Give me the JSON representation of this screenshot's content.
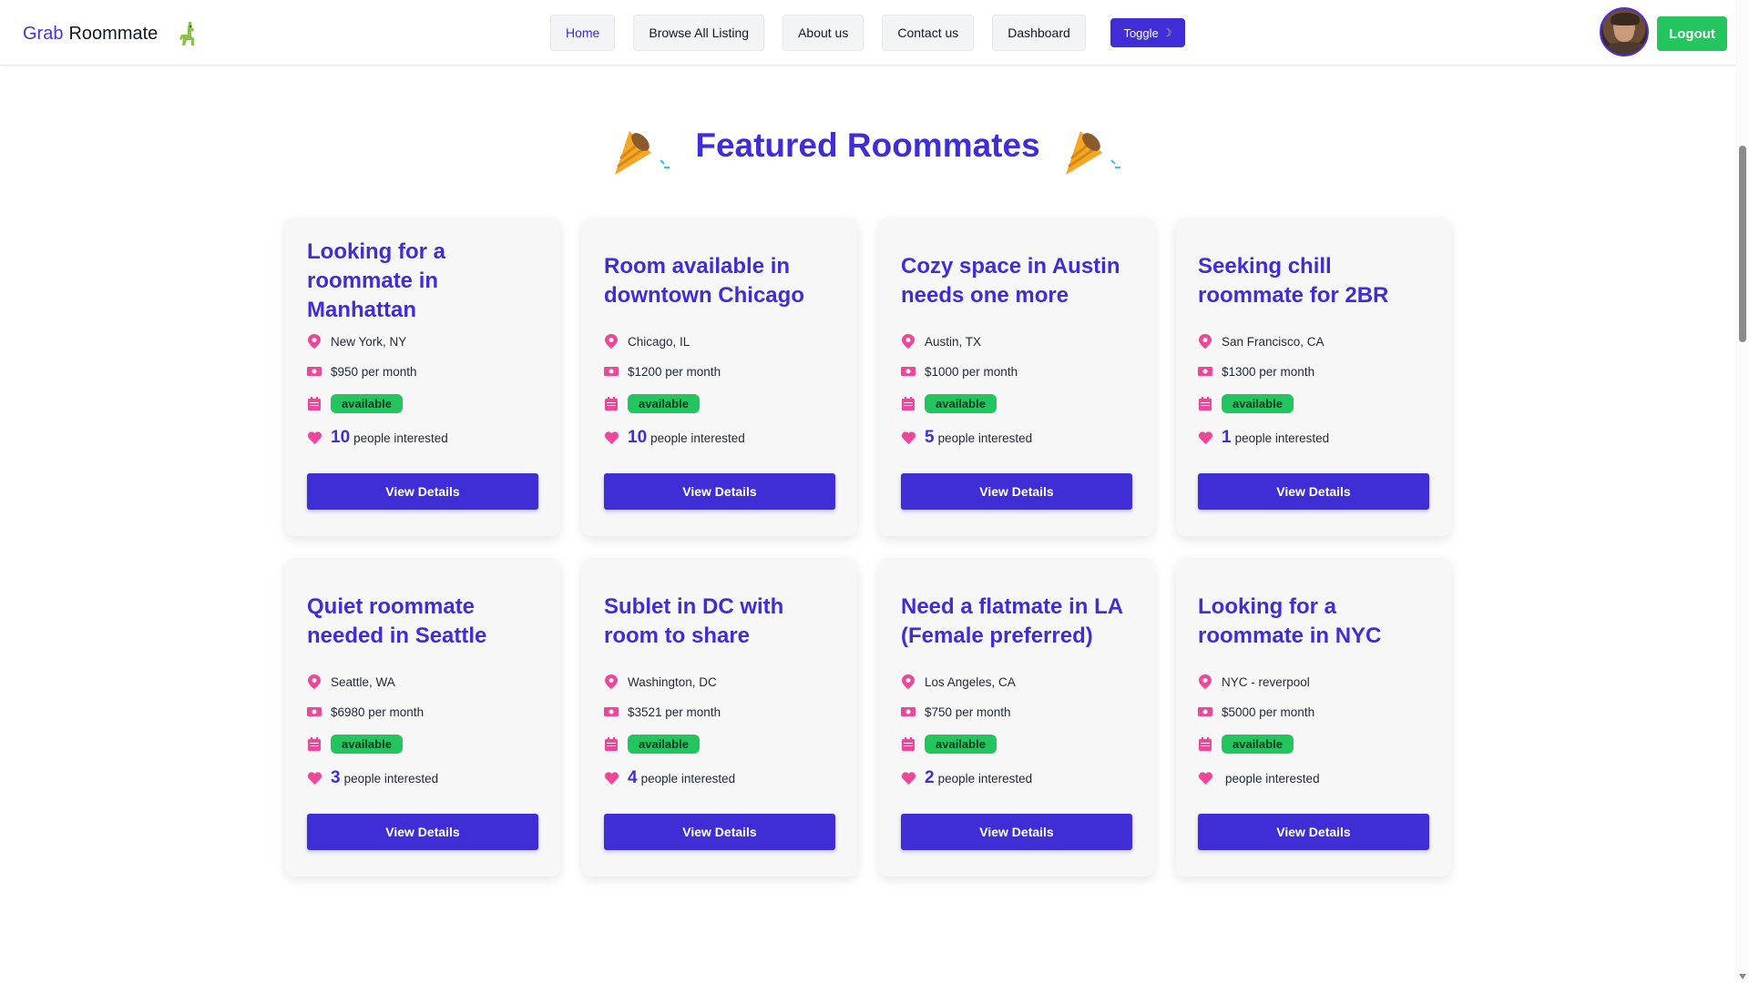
{
  "brand": {
    "part1": "Grab",
    "part2": "Roommate",
    "logo_icon": "llama-icon"
  },
  "nav": {
    "links": [
      "Home",
      "Browse All Listing",
      "About us",
      "Contact us",
      "Dashboard"
    ],
    "toggle_label": "Toggle",
    "toggle_icon": "moon-icon",
    "logout_label": "Logout"
  },
  "featured": {
    "title": "Featured Roommates",
    "decor_icon": "party-popper-icon"
  },
  "colors": {
    "accent": "#3f2ed6",
    "success": "#22c55e",
    "icon_pink": "#ec4899"
  },
  "listings": [
    {
      "title": "Looking for a roommate in Manhattan",
      "location": "New York, NY",
      "price": "$950 per month",
      "status": "available",
      "interested_count": "10",
      "interested_label": "people interested",
      "button": "View Details"
    },
    {
      "title": "Room available in downtown Chicago",
      "location": "Chicago, IL",
      "price": "$1200 per month",
      "status": "available",
      "interested_count": "10",
      "interested_label": "people interested",
      "button": "View Details"
    },
    {
      "title": "Cozy space in Austin needs one more",
      "location": "Austin, TX",
      "price": "$1000 per month",
      "status": "available",
      "interested_count": "5",
      "interested_label": "people interested",
      "button": "View Details"
    },
    {
      "title": "Seeking chill roommate for 2BR",
      "location": "San Francisco, CA",
      "price": "$1300 per month",
      "status": "available",
      "interested_count": "1",
      "interested_label": "people interested",
      "button": "View Details"
    },
    {
      "title": "Quiet roommate needed in Seattle",
      "location": "Seattle, WA",
      "price": "$6980 per month",
      "status": "available",
      "interested_count": "3",
      "interested_label": "people interested",
      "button": "View Details"
    },
    {
      "title": "Sublet in DC with room to share",
      "location": "Washington, DC",
      "price": "$3521 per month",
      "status": "available",
      "interested_count": "4",
      "interested_label": "people interested",
      "button": "View Details"
    },
    {
      "title": "Need a flatmate in LA (Female preferred)",
      "location": "Los Angeles, CA",
      "price": "$750 per month",
      "status": "available",
      "interested_count": "2",
      "interested_label": "people interested",
      "button": "View Details"
    },
    {
      "title": "Looking for a roommate in NYC",
      "location": "NYC - reverpool",
      "price": "$5000 per month",
      "status": "available",
      "interested_count": "",
      "interested_label": "people interested",
      "button": "View Details"
    }
  ]
}
